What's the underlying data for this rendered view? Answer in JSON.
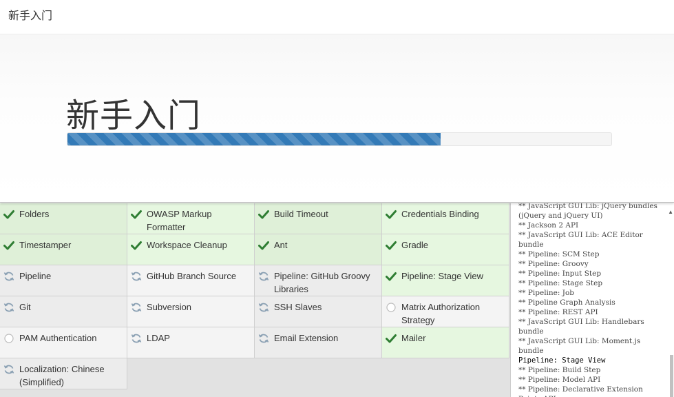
{
  "topbar": {
    "title": "新手入门"
  },
  "hero": {
    "heading": "新手入门",
    "progress": 0.686
  },
  "colors": {
    "success_icon": "#2e7d32",
    "spinner_icon": "#8aa0b3",
    "pending_icon": "#bbbbbb",
    "progress_fill": "#337ab7"
  },
  "plugins": [
    {
      "label": "Folders",
      "status": "success"
    },
    {
      "label": "OWASP Markup Formatter",
      "status": "success"
    },
    {
      "label": "Build Timeout",
      "status": "success"
    },
    {
      "label": "Credentials Binding",
      "status": "success"
    },
    {
      "label": "Timestamper",
      "status": "success"
    },
    {
      "label": "Workspace Cleanup",
      "status": "success"
    },
    {
      "label": "Ant",
      "status": "success"
    },
    {
      "label": "Gradle",
      "status": "success"
    },
    {
      "label": "Pipeline",
      "status": "installing"
    },
    {
      "label": "GitHub Branch Source",
      "status": "installing"
    },
    {
      "label": "Pipeline: GitHub Groovy Libraries",
      "status": "installing"
    },
    {
      "label": "Pipeline: Stage View",
      "status": "success"
    },
    {
      "label": "Git",
      "status": "installing"
    },
    {
      "label": "Subversion",
      "status": "installing"
    },
    {
      "label": "SSH Slaves",
      "status": "installing"
    },
    {
      "label": "Matrix Authorization Strategy",
      "status": "pending"
    },
    {
      "label": "PAM Authentication",
      "status": "pending"
    },
    {
      "label": "LDAP",
      "status": "installing"
    },
    {
      "label": "Email Extension",
      "status": "installing"
    },
    {
      "label": "Mailer",
      "status": "success"
    },
    {
      "label": "Localization: Chinese (Simplified)",
      "status": "installing"
    }
  ],
  "log": [
    {
      "text": "** JavaScript GUI Lib: jQuery bundles (jQuery and jQuery UI)",
      "head": false
    },
    {
      "text": "** Jackson 2 API",
      "head": false
    },
    {
      "text": "** JavaScript GUI Lib: ACE Editor bundle",
      "head": false
    },
    {
      "text": "** Pipeline: SCM Step",
      "head": false
    },
    {
      "text": "** Pipeline: Groovy",
      "head": false
    },
    {
      "text": "** Pipeline: Input Step",
      "head": false
    },
    {
      "text": "** Pipeline: Stage Step",
      "head": false
    },
    {
      "text": "** Pipeline: Job",
      "head": false
    },
    {
      "text": "** Pipeline Graph Analysis",
      "head": false
    },
    {
      "text": "** Pipeline: REST API",
      "head": false
    },
    {
      "text": "** JavaScript GUI Lib: Handlebars bundle",
      "head": false
    },
    {
      "text": "** JavaScript GUI Lib: Moment.js bundle",
      "head": false
    },
    {
      "text": "Pipeline: Stage View",
      "head": true
    },
    {
      "text": "** Pipeline: Build Step",
      "head": false
    },
    {
      "text": "** Pipeline: Model API",
      "head": false
    },
    {
      "text": "** Pipeline: Declarative Extension Points API",
      "head": false
    }
  ]
}
